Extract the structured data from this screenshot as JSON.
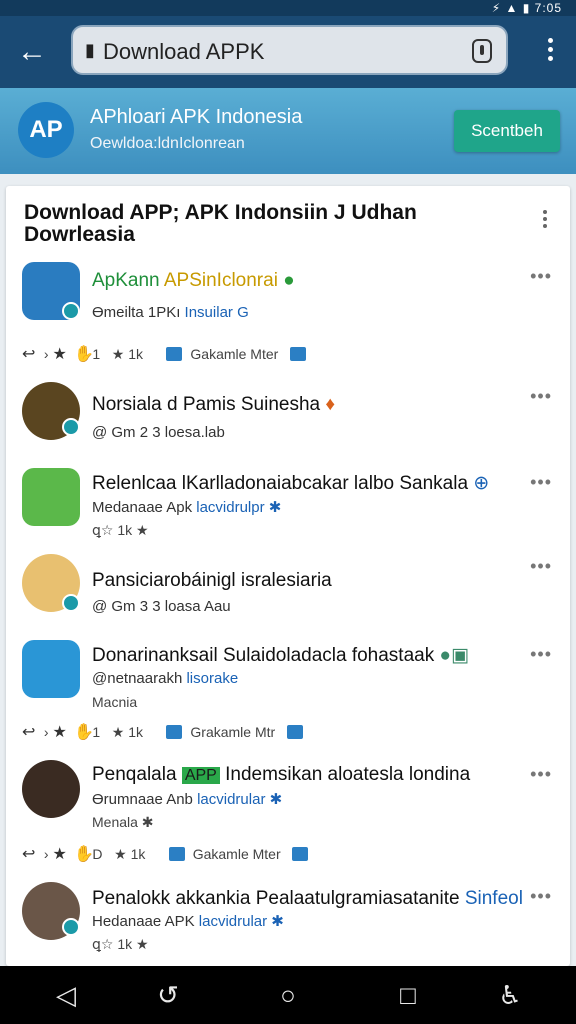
{
  "status_bar": {
    "right": "⚡ ▲ ▮ 7:05"
  },
  "search": {
    "prefix_icon": "lock",
    "value": "Download APPK",
    "mic_icon": "clipboard"
  },
  "banner": {
    "title": "APhloari APK Indonesia",
    "subtitle": "Oewldoa:ldnIclonrean",
    "button": "Scentbeh",
    "logo": "AP"
  },
  "card": {
    "title": "Download APP; APK Indonsiin J Udhan Dowrleasia"
  },
  "items": [
    {
      "name": "ApKann",
      "name_highlight": "APSinIclonrai",
      "sub_prefix": "Өmeilta 1PKı",
      "sub_tag": "Insuilar",
      "sub_suffix": "G",
      "meta": {
        "rating1": "1",
        "rating2": "1k",
        "store": "Gakamle Mter"
      }
    },
    {
      "name": "Norsiala d Pamis Suinesha",
      "sub_prefix": "@ Gm 2 3 loesa.lab"
    },
    {
      "name": "Relenlcaa lKarlladonaiabcakar lalbo Sankala",
      "sub_prefix": "Medanaae Apk",
      "sub_tag": "lacvidrulpr",
      "sub_suffix": "✱",
      "extra": "ꝗ☆ 1k ★"
    },
    {
      "name": "Pansiciarobáinigl isralesiaria",
      "sub_prefix": "@ Gm 3 3 loasa Aau"
    },
    {
      "name": "Donarinanksail Sulaidoladacla fohastaak",
      "sub_prefix": "@netnaarakh",
      "sub_tag": "lisorake",
      "extra": "Macnia",
      "meta": {
        "rating1": "1",
        "rating2": "1k",
        "store": "Grakamle Mtr"
      }
    },
    {
      "name": "Penqalala",
      "name_highlight": "APP",
      "name_suffix": "Indemsikan aloatesla londina",
      "sub_prefix": "Өrumnaae Anb",
      "sub_tag": "lacvidrular",
      "sub_suffix": "✱",
      "extra": "Menala ✱",
      "meta": {
        "rating1": "D",
        "rating2": "1k",
        "store": "Gakamle Mter"
      }
    },
    {
      "name": "Penalokk akkankia Pealaatulgramiasatanite",
      "name_tail": "Sinfeol",
      "sub_prefix": "Hedanaae APK",
      "sub_tag": "lacvidrular",
      "sub_suffix": "✱",
      "extra": "ꝗ☆ 1k ★"
    }
  ],
  "colors": {
    "topbar": "#1a4a74",
    "banner": "#4a9fca",
    "accent_button": "#1fa58a",
    "link": "#1a62b5"
  }
}
